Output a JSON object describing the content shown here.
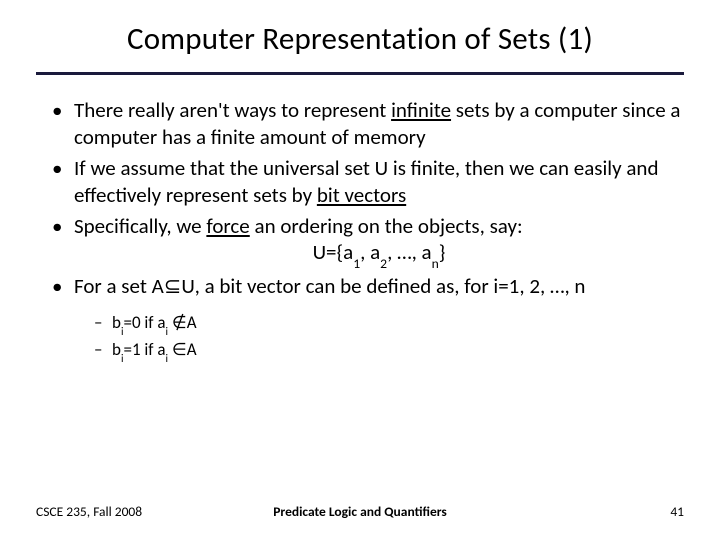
{
  "title": "Computer Representation of Sets (1)",
  "bullets": {
    "b1_pre": "There really aren't ways to represent ",
    "b1_u": "infinite",
    "b1_post": " sets by a computer since a computer has a finite amount of memory",
    "b2_pre": "If we assume that the universal set U is finite, then we can easily and effectively represent sets by ",
    "b2_u": "bit vectors",
    "b3_pre": "Specifically, we ",
    "b3_u": "force",
    "b3_post": " an ordering on the objects, say:",
    "formula_pre": "U={a",
    "formula_s1": "1",
    "formula_m1": ", a",
    "formula_s2": "2",
    "formula_m2": ", …, a",
    "formula_s3": "n",
    "formula_post": "}",
    "b4": "For a set A⊆U, a bit vector can be defined as, for i=1, 2, …, n"
  },
  "sub": {
    "s1_pre": "b",
    "s1_sub": "i",
    "s1_mid": "=0 if a",
    "s1_sub2": "i",
    "s1_post": " ∉A",
    "s2_pre": "b",
    "s2_sub": "i",
    "s2_mid": "=1 if a",
    "s2_sub2": "i",
    "s2_post": " ∈A"
  },
  "footer": {
    "left": "CSCE 235, Fall 2008",
    "center": "Predicate Logic and Quantifiers",
    "right": "41"
  }
}
